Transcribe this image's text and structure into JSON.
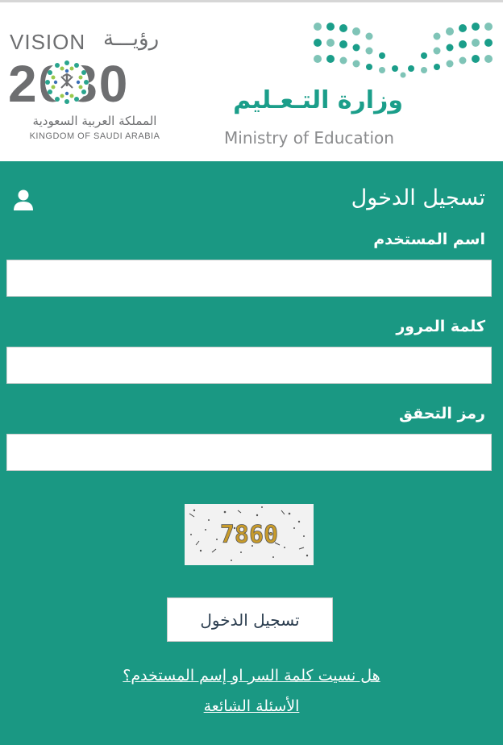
{
  "header": {
    "vision_en": "VISION",
    "vision_ar": "رؤيـــة",
    "vision_year": "2030",
    "kingdom_ar": "المملكة العربية السعودية",
    "kingdom_en": "KINGDOM OF SAUDI ARABIA",
    "ministry_ar": "وزارة التـعـليم",
    "ministry_en": "Ministry of Education"
  },
  "colors": {
    "brand_green": "#1a9883",
    "logo_gray": "#6d6e70"
  },
  "login": {
    "title": "تسجيل الدخول",
    "username_label": "اسم المستخدم",
    "username_value": "",
    "password_label": "كلمة المرور",
    "password_value": "",
    "captcha_label": "رمز التحقق",
    "captcha_value": "",
    "captcha_text": "7860",
    "submit_label": "تسجيل الدخول",
    "forgot_link": "هل نسيت كلمة السر او إسم المستخدم؟",
    "faq_link": "الأسئلة الشائعة"
  },
  "icons": {
    "user": "user-icon"
  }
}
